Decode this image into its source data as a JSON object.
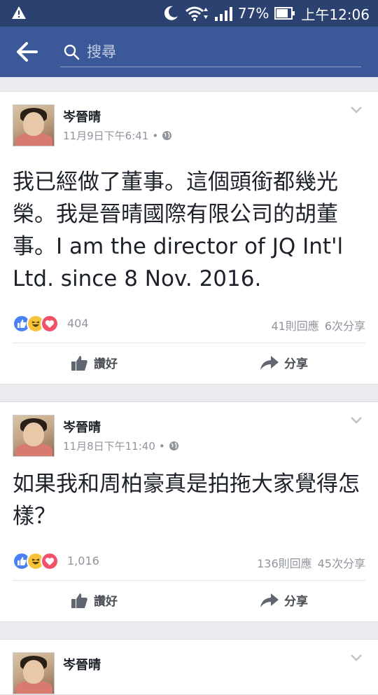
{
  "status": {
    "battery": "77%",
    "time": "上午12:06",
    "icons": [
      "warning-icon",
      "moon-icon",
      "wifi-icon",
      "signal-icon",
      "battery-icon"
    ]
  },
  "search": {
    "placeholder": "搜尋"
  },
  "posts": [
    {
      "author": "岑晉晴",
      "time": "11月9日下午6:41",
      "text": "我已經做了董事。這個頭銜都幾光榮。我是晉晴國際有限公司的胡董事。I am the director of JQ Int'l Ltd. since 8 Nov. 2016.",
      "reactions": "404",
      "comments": "41則回應",
      "shares": "6次分享",
      "like_label": "讚好",
      "share_label": "分享"
    },
    {
      "author": "岑晉晴",
      "time": "11月8日下午11:40",
      "text": "如果我和周柏豪真是拍拖大家覺得怎樣？",
      "reactions": "1,016",
      "comments": "136則回應",
      "shares": "45次分享",
      "like_label": "讚好",
      "share_label": "分享"
    },
    {
      "author": "岑晉晴"
    }
  ],
  "colors": {
    "brand": "#3b5998",
    "status_bar": "#2b4170",
    "like": "#4a80f5",
    "haha": "#f7c33b",
    "love": "#f25268"
  }
}
